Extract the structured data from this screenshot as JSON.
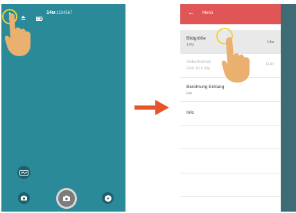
{
  "left_screen": {
    "status": {
      "mode_label": "14ᴍ",
      "code_label": "1234567"
    }
  },
  "right_screen": {
    "header": {
      "back_glyph": "←",
      "title": "Menü"
    },
    "items": [
      {
        "label": "Bildgröße",
        "sub": "14M",
        "value": "14ᴍ",
        "state": "selected"
      },
      {
        "label": "Videoformat",
        "sub": "FHD 16:9 30p",
        "value": "FHD",
        "state": "disabled"
      },
      {
        "label": "Berührung Einfang",
        "sub": "Ein",
        "value": "",
        "state": "normal"
      },
      {
        "label": "Info",
        "sub": "",
        "value": "",
        "state": "normal"
      }
    ]
  },
  "colors": {
    "camera_bg": "#2b8a9a",
    "menu_header": "#e05555",
    "arrow": "#e8542a",
    "tap_ring": "#f2d338",
    "hand": "#e9b070"
  }
}
